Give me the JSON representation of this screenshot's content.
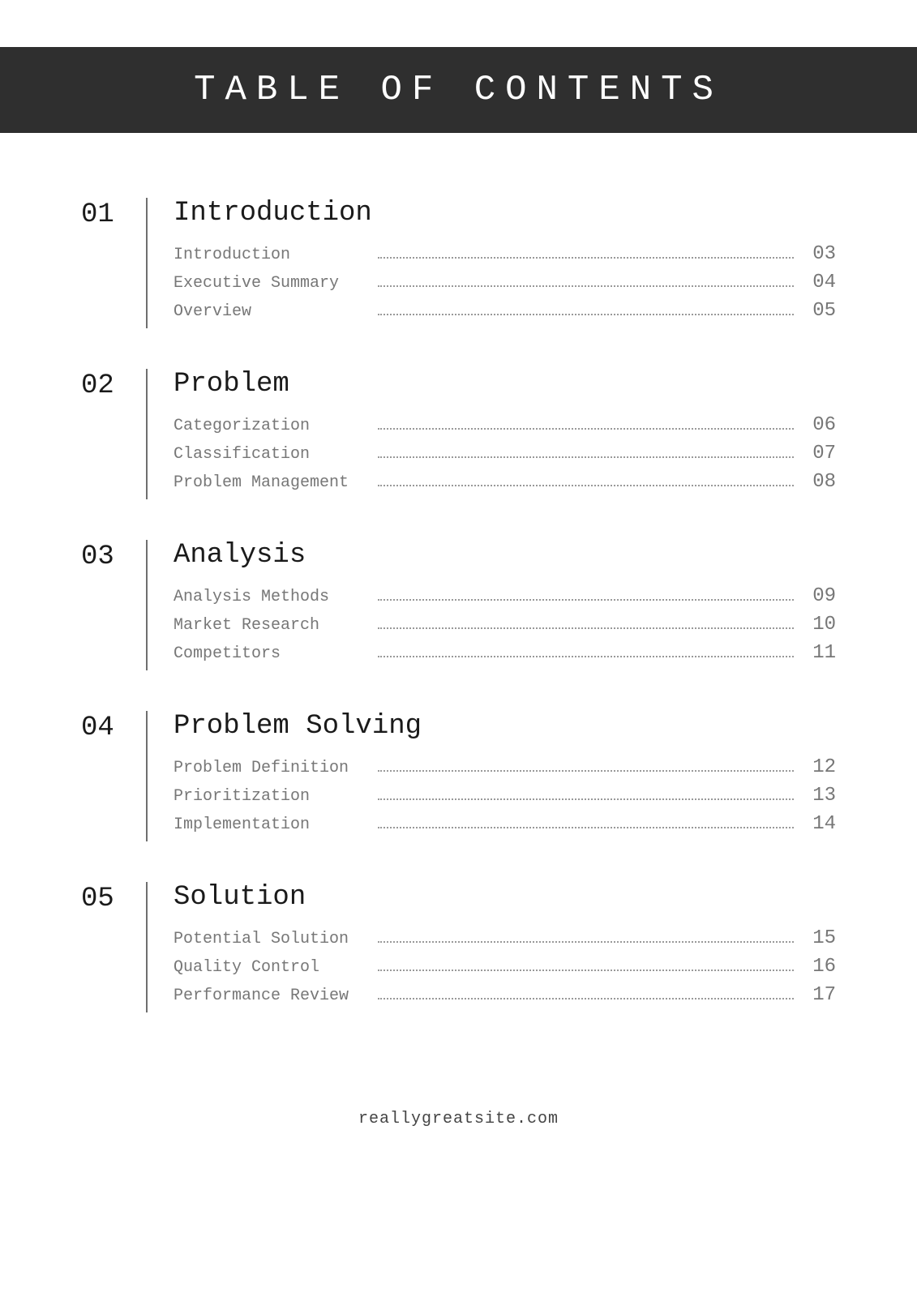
{
  "header": {
    "title": "TABLE OF CONTENTS"
  },
  "sections": [
    {
      "number": "01",
      "title": "Introduction",
      "entries": [
        {
          "label": "Introduction",
          "page": "03"
        },
        {
          "label": "Executive Summary",
          "page": "04"
        },
        {
          "label": "Overview",
          "page": "05"
        }
      ]
    },
    {
      "number": "02",
      "title": "Problem",
      "entries": [
        {
          "label": "Categorization",
          "page": "06"
        },
        {
          "label": "Classification",
          "page": "07"
        },
        {
          "label": "Problem Management",
          "page": "08"
        }
      ]
    },
    {
      "number": "03",
      "title": "Analysis",
      "entries": [
        {
          "label": "Analysis Methods",
          "page": "09"
        },
        {
          "label": "Market Research",
          "page": "10"
        },
        {
          "label": "Competitors",
          "page": "11"
        }
      ]
    },
    {
      "number": "04",
      "title": "Problem Solving",
      "entries": [
        {
          "label": "Problem Definition",
          "page": "12"
        },
        {
          "label": "Prioritization",
          "page": "13"
        },
        {
          "label": "Implementation",
          "page": "14"
        }
      ]
    },
    {
      "number": "05",
      "title": "Solution",
      "entries": [
        {
          "label": "Potential Solution",
          "page": "15"
        },
        {
          "label": "Quality Control",
          "page": "16"
        },
        {
          "label": "Performance Review",
          "page": "17"
        }
      ]
    }
  ],
  "footer": {
    "url": "reallygreatsite.com"
  }
}
